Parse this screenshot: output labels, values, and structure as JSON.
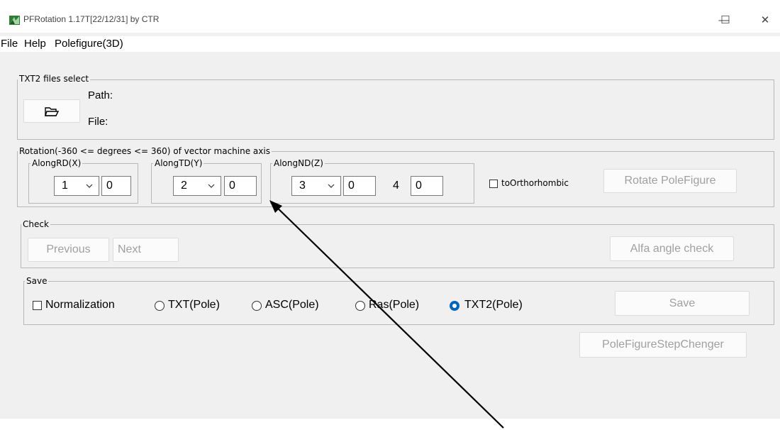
{
  "window": {
    "title": "PFRotation 1.17T[22/12/31] by CTR",
    "controls": {
      "minimize": "—",
      "maximize": "☐",
      "close": "✕"
    }
  },
  "menu": [
    "File",
    "Help",
    "Polefigure(3D)"
  ],
  "txt2_group": {
    "legend": "TXT2 files select",
    "path_label": "Path:",
    "file_label": "File:",
    "open_icon": "open-folder-icon"
  },
  "rotation_group": {
    "legend": "Rotation(-360 <= degrees <= 360) of vector machine axis",
    "rd": {
      "legend": "AlongRD(X)",
      "axis_value": "1",
      "angle": "0"
    },
    "td": {
      "legend": "AlongTD(Y)",
      "axis_value": "2",
      "angle": "0"
    },
    "nd": {
      "legend": "AlongND(Z)",
      "axis_value": "3",
      "angle": "0",
      "extra_label": "4",
      "extra_value": "0"
    },
    "orthorhombic_label": "toOrthorhombic",
    "orthorhombic_checked": false,
    "rotate_button": "Rotate PoleFigure"
  },
  "check_group": {
    "legend": "Check",
    "previous_button": "Previous",
    "next_button": "Next",
    "alfa_button": "Alfa angle check"
  },
  "save_group": {
    "legend": "Save",
    "normalization_label": "Normalization",
    "normalization_checked": false,
    "formats": [
      "TXT(Pole)",
      "ASC(Pole)",
      "Ras(Pole)",
      "TXT2(Pole)"
    ],
    "selected_format": "TXT2(Pole)",
    "save_button": "Save"
  },
  "step_changer_button": "PoleFigureStepChenger",
  "colors": {
    "accent": "#0067c0",
    "disabled_text": "#a0a0a0",
    "window_bg": "#f0f0f0"
  }
}
